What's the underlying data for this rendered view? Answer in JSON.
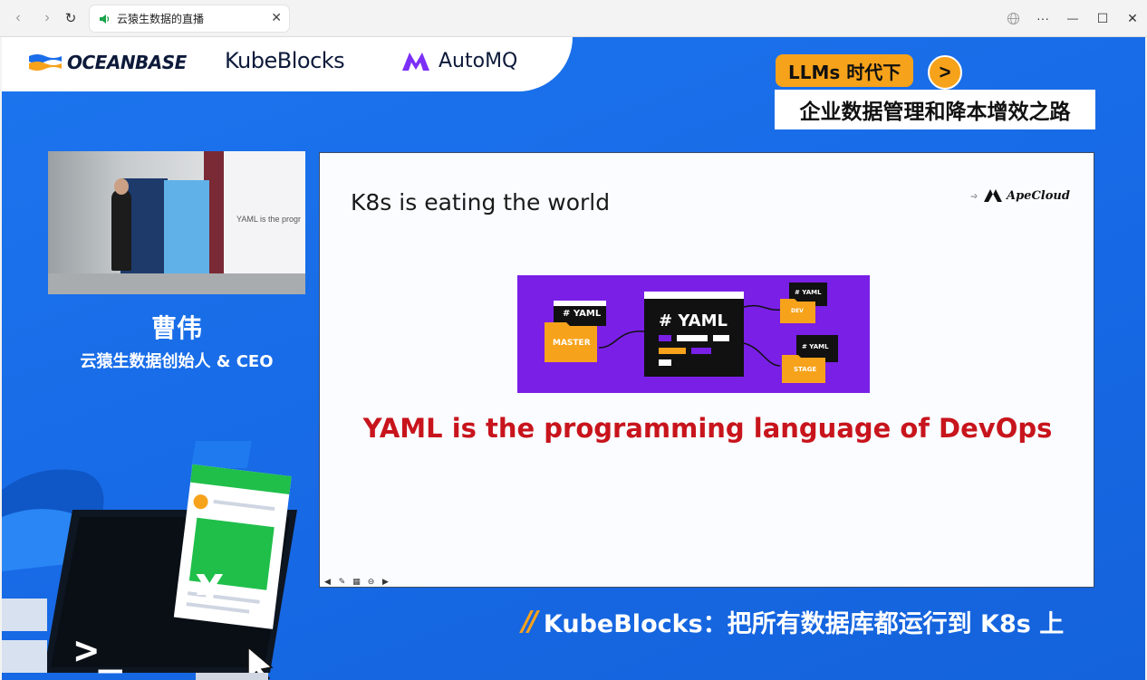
{
  "browser": {
    "tab_title": "云猿生数据的直播",
    "back_icon": "‹",
    "forward_icon": "›",
    "reload_icon": "↻",
    "close_tab": "✕",
    "more_icon": "···",
    "minimize": "—",
    "maximize": "☐",
    "close_window": "✕"
  },
  "banner": {
    "logos": [
      "OCEANBASE",
      "KubeBlocks",
      "AutoMQ"
    ]
  },
  "topic": {
    "tag": "LLMs 时代下",
    "arrow": ">",
    "title": "企业数据管理和降本增效之路"
  },
  "camera": {
    "screen_text": "YAML is the progr"
  },
  "speaker": {
    "name": "曹伟",
    "title": "云猿生数据创始人 & CEO"
  },
  "slide": {
    "title": "K8s is eating the world",
    "brand": "ApeCloud",
    "brand_arrow": "--›",
    "figure": {
      "main_label": "# YAML",
      "left_label": "# YAML",
      "left_folder": "MASTER",
      "top_right_label": "# YAML",
      "top_right_folder": "DEV",
      "bottom_right_label": "# YAML",
      "bottom_right_folder": "STAGE"
    },
    "caption": "YAML is the programming language of DevOps",
    "controls": [
      "◀",
      "✎",
      "▦",
      "⊖",
      "▶"
    ]
  },
  "bottom_caption": {
    "slashes": "//",
    "text": "KubeBlocks：把所有数据库都运行到 K8s 上"
  },
  "illustration": {
    "currency_symbol": "¥",
    "prompt_symbol": ">_"
  },
  "colors": {
    "stream_blue": "#1a6ee9",
    "accent_orange": "#f7a21b",
    "caption_red": "#c8141c",
    "figure_purple": "#7a1fe6",
    "currency_green": "#1fbf4a"
  }
}
